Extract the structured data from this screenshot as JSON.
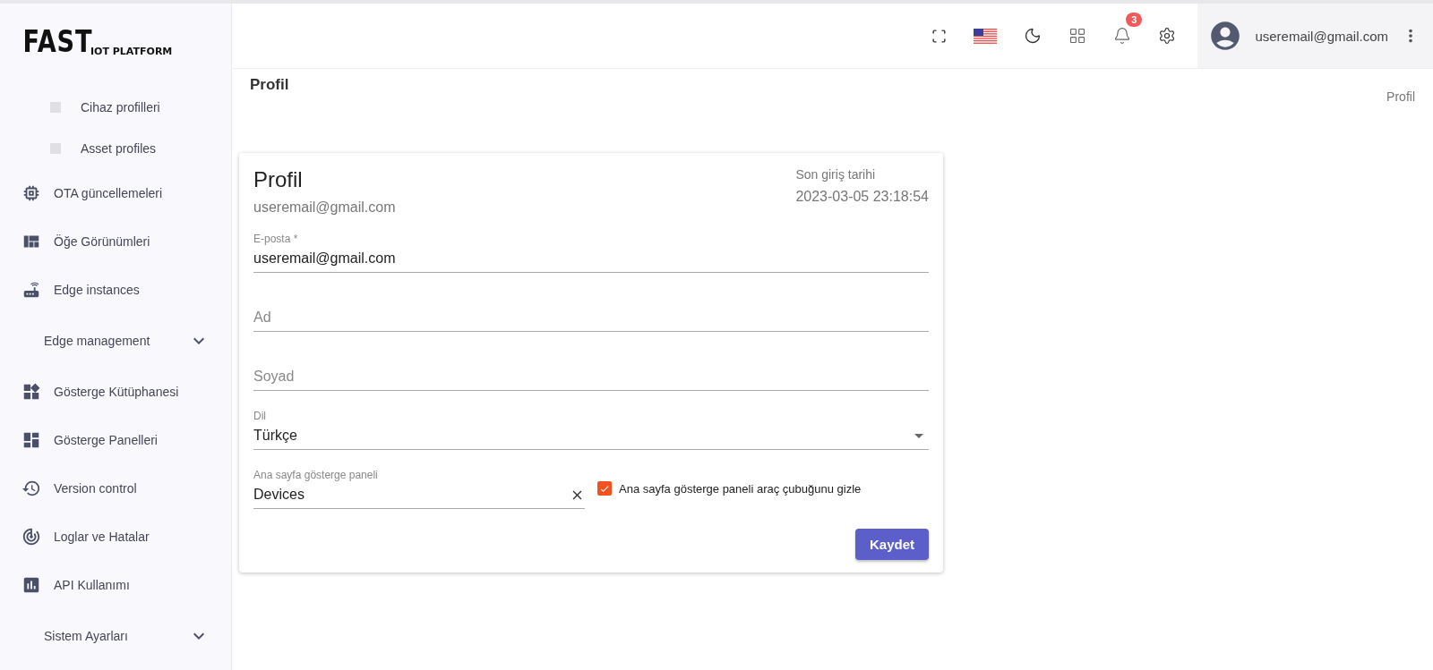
{
  "logo": {
    "main": "FAST",
    "sub": "IOT PLATFORM"
  },
  "sidebar": {
    "items": [
      {
        "kind": "sub",
        "label": "Cihaz profilleri"
      },
      {
        "kind": "sub",
        "label": "Asset profiles"
      },
      {
        "kind": "link",
        "label": "OTA güncellemeleri"
      },
      {
        "kind": "link",
        "label": "Öğe Görünümleri"
      },
      {
        "kind": "link",
        "label": "Edge instances"
      },
      {
        "kind": "section",
        "label": "Edge management"
      },
      {
        "kind": "link",
        "label": "Gösterge Kütüphanesi"
      },
      {
        "kind": "link",
        "label": "Gösterge Panelleri"
      },
      {
        "kind": "link",
        "label": "Version control"
      },
      {
        "kind": "link",
        "label": "Loglar ve Hatalar"
      },
      {
        "kind": "link",
        "label": "API Kullanımı"
      },
      {
        "kind": "section",
        "label": "Sistem Ayarları"
      }
    ]
  },
  "header": {
    "notification_count": "3",
    "user": "useremail@gmail.com"
  },
  "page": {
    "title": "Profil",
    "breadcrumb": "Profil"
  },
  "card": {
    "title": "Profil",
    "email": "useremail@gmail.com",
    "last_login_label": "Son giriş tarihi",
    "last_login": "2023-03-05 23:18:54",
    "fields": [
      {
        "kind": "text",
        "label": "E-posta *",
        "value": "useremail@gmail.com"
      },
      {
        "kind": "empty",
        "placeholder": "Ad"
      },
      {
        "kind": "empty",
        "placeholder": "Soyad"
      },
      {
        "kind": "select",
        "label": "Dil",
        "value": "Türkçe"
      },
      {
        "kind": "dashboard",
        "label": "Ana sayfa gösterge paneli",
        "value": "Devices",
        "checkbox": {
          "label": "Ana sayfa gösterge paneli araç çubuğunu gizle",
          "checked": true
        }
      }
    ],
    "save": "Kaydet"
  }
}
